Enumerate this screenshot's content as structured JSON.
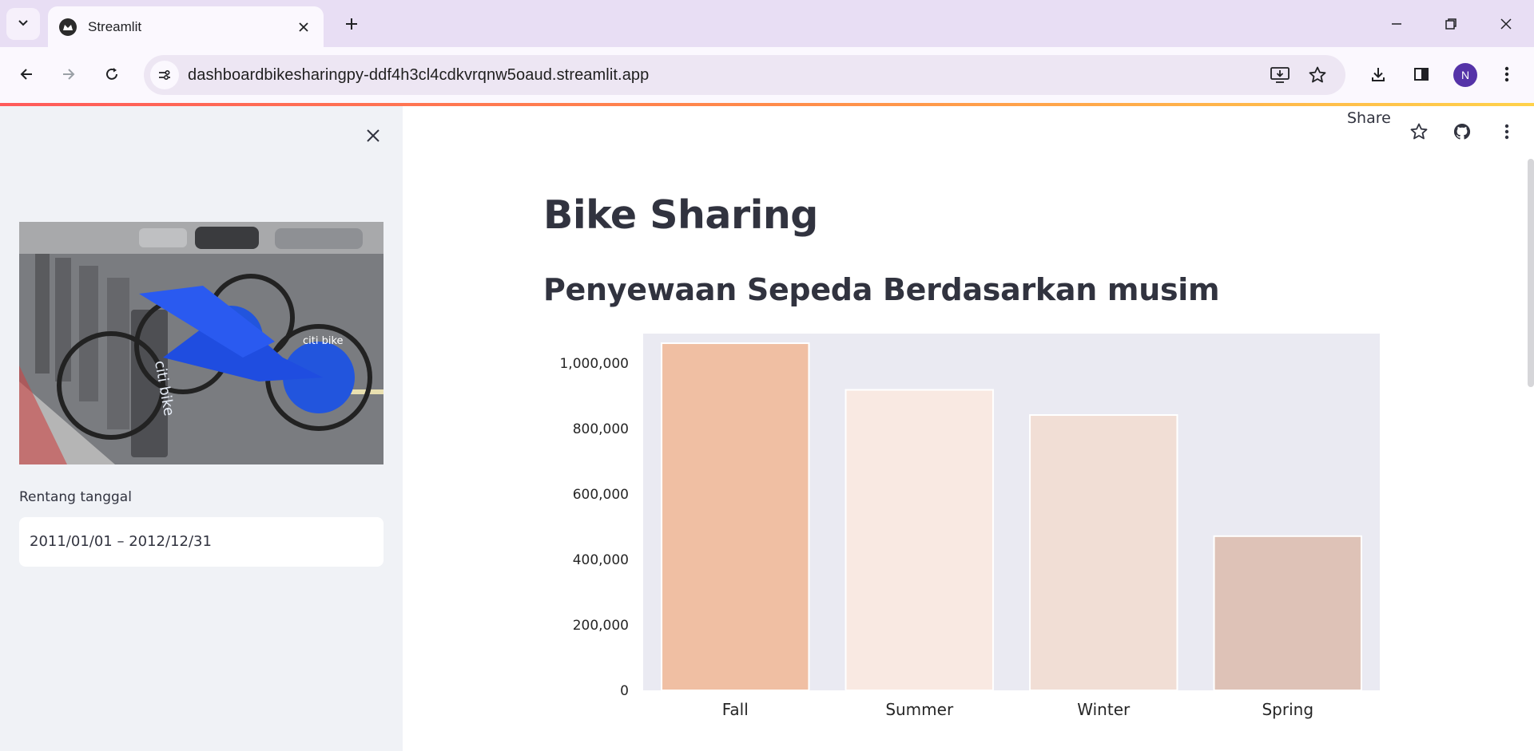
{
  "browser": {
    "tab_title": "Streamlit",
    "url": "dashboardbikesharingpy-ddf4h3cl4cdkvrqnw5oaud.streamlit.app",
    "profile_initial": "N",
    "icons": [
      "tab-search-icon",
      "streamlit-favicon",
      "close-icon",
      "plus-icon",
      "minimize-icon",
      "restore-icon",
      "back-icon",
      "forward-icon",
      "reload-icon",
      "site-info-icon",
      "install-app-icon",
      "star-icon",
      "download-icon",
      "side-panel-icon",
      "more-vert-icon"
    ]
  },
  "sidebar": {
    "image_alt": "citi bike",
    "date_label": "Rentang tanggal",
    "date_value": "2011/01/01 – 2012/12/31"
  },
  "header": {
    "share_label": "Share",
    "icons": [
      "star-icon",
      "github-icon",
      "more-vert-icon"
    ]
  },
  "main": {
    "title": "Bike Sharing",
    "subheader": "Penyewaan Sepeda Berdasarkan musim"
  },
  "chart_data": {
    "type": "bar",
    "title": "",
    "xlabel": "",
    "ylabel": "",
    "categories": [
      "Fall",
      "Summer",
      "Winter",
      "Spring"
    ],
    "values": [
      1061129,
      918589,
      841613,
      471348
    ],
    "colors": [
      "#f0bfa3",
      "#f9e9e2",
      "#f1ded5",
      "#dec2b7"
    ],
    "ylim": [
      0,
      1110000
    ],
    "yticks": [
      0,
      200000,
      400000,
      600000,
      800000,
      1000000
    ],
    "ytick_labels": [
      "0",
      "200,000",
      "400,000",
      "600,000",
      "800,000",
      "1,000,000"
    ],
    "plot_background": "#eaeaf2",
    "grid": false
  }
}
